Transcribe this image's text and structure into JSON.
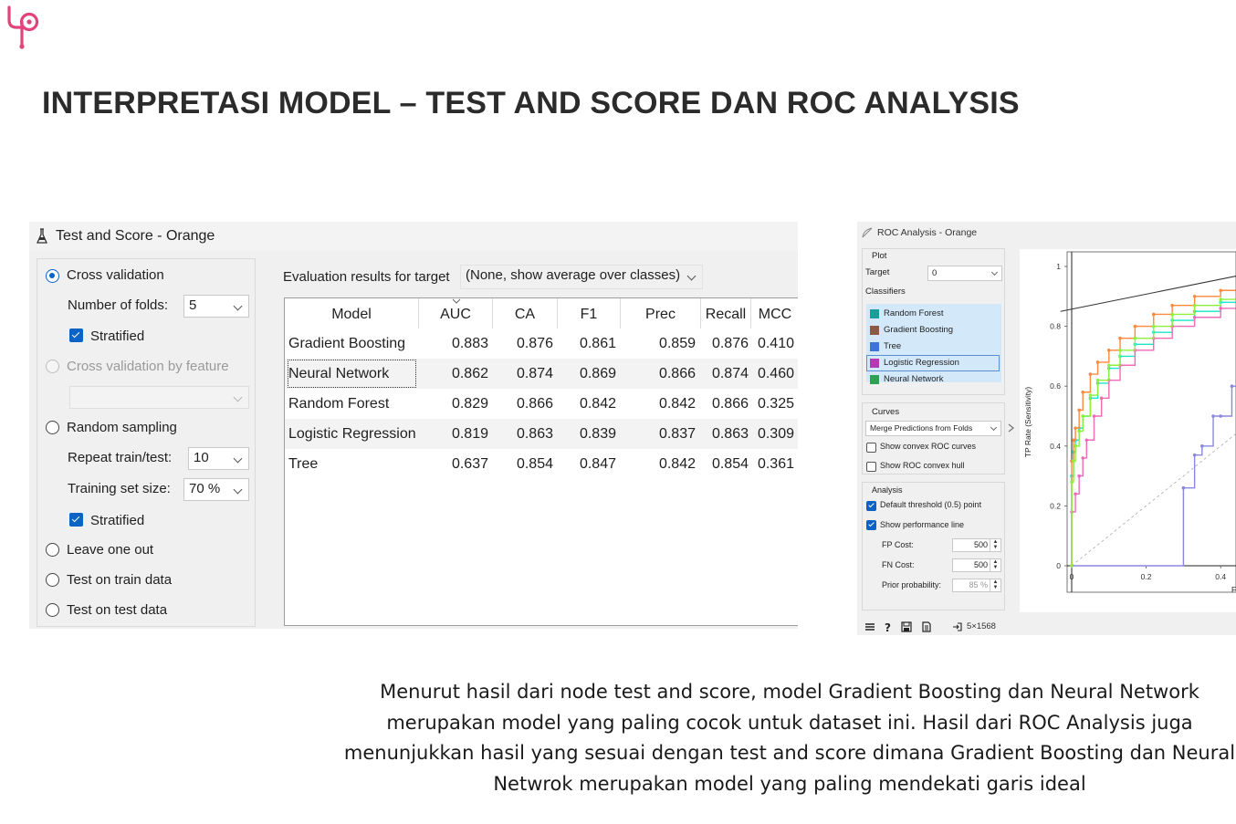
{
  "slide": {
    "title": "INTERPRETASI MODEL – TEST AND SCORE DAN ROC ANALYSIS",
    "caption": "Menurut hasil dari node test and score, model Gradient Boosting dan Neural Network merupakan model yang paling cocok untuk dataset ini. Hasil dari ROC Analysis juga menunjukkan hasil yang sesuai dengan test and score dimana Gradient Boosting dan Neural Netwrok merupakan model yang paling mendekati garis ideal",
    "accent_color": "#e0447a",
    "logo_icon": "brand-logo-icon"
  },
  "test_and_score": {
    "window_title": "Test and Score - Orange",
    "sampling": {
      "cross_validation": "Cross validation",
      "number_of_folds_label": "Number of folds:",
      "number_of_folds": "5",
      "stratified_1": "Stratified",
      "cross_validation_by_feature": "Cross validation by feature",
      "feature_value": "",
      "random_sampling": "Random sampling",
      "repeat_label": "Repeat train/test:",
      "repeat_value": "10",
      "training_size_label": "Training set size:",
      "training_size_value": "70 %",
      "stratified_2": "Stratified",
      "leave_one_out": "Leave one out",
      "test_on_train": "Test on train data",
      "test_on_test": "Test on test data",
      "selected": "Cross validation"
    },
    "eval_label": "Evaluation results for target",
    "eval_target": "(None, show average over classes)",
    "columns": [
      "Model",
      "AUC",
      "CA",
      "F1",
      "Prec",
      "Recall",
      "MCC"
    ],
    "sorted_column": "AUC",
    "rows": [
      {
        "model": "Gradient Boosting",
        "auc": "0.883",
        "ca": "0.876",
        "f1": "0.861",
        "prec": "0.859",
        "recall": "0.876",
        "mcc": "0.410"
      },
      {
        "model": "Neural Network",
        "auc": "0.862",
        "ca": "0.874",
        "f1": "0.869",
        "prec": "0.866",
        "recall": "0.874",
        "mcc": "0.460"
      },
      {
        "model": "Random Forest",
        "auc": "0.829",
        "ca": "0.866",
        "f1": "0.842",
        "prec": "0.842",
        "recall": "0.866",
        "mcc": "0.325"
      },
      {
        "model": "Logistic Regression",
        "auc": "0.819",
        "ca": "0.863",
        "f1": "0.839",
        "prec": "0.837",
        "recall": "0.863",
        "mcc": "0.309"
      },
      {
        "model": "Tree",
        "auc": "0.637",
        "ca": "0.854",
        "f1": "0.847",
        "prec": "0.842",
        "recall": "0.854",
        "mcc": "0.361"
      }
    ]
  },
  "roc": {
    "window_title": "ROC Analysis - Orange",
    "plot_box_label": "Plot",
    "target_label": "Target",
    "target_value": "0",
    "classifiers_label": "Classifiers",
    "classifiers": [
      {
        "name": "Random Forest",
        "color": "#1a9e9a"
      },
      {
        "name": "Gradient Boosting",
        "color": "#8a5a44"
      },
      {
        "name": "Tree",
        "color": "#3f73d6"
      },
      {
        "name": "Logistic Regression",
        "color": "#b23ab5"
      },
      {
        "name": "Neural Network",
        "color": "#2ea253"
      }
    ],
    "curves_label": "Curves",
    "merge_option": "Merge Predictions from Folds",
    "show_convex_curves": "Show convex ROC curves",
    "show_convex_hull": "Show ROC convex hull",
    "analysis_label": "Analysis",
    "default_threshold": "Default threshold (0.5) point",
    "show_performance_line": "Show performance line",
    "fp_cost_label": "FP Cost:",
    "fp_cost": "500",
    "fn_cost_label": "FN Cost:",
    "fn_cost": "500",
    "prior_label": "Prior probability:",
    "prior_value": "85 %",
    "status_size": "5×1568",
    "y_axis_label": "TP Rate (Sensitivity)",
    "x_axis_label": "FP Ra",
    "y_ticks": [
      "1",
      "0.8",
      "0.6",
      "0.4",
      "0.2",
      "0"
    ],
    "x_ticks": [
      "0",
      "0.2",
      "0.4"
    ],
    "chart_data": {
      "type": "line",
      "title": "",
      "xlabel": "FP Ra",
      "ylabel": "TP Rate (Sensitivity)",
      "xlim": [
        0,
        0.45
      ],
      "ylim": [
        0,
        1.05
      ],
      "series": [
        {
          "name": "Random Forest",
          "color": "#19e6c8",
          "x": [
            0,
            0,
            0.005,
            0.01,
            0.02,
            0.03,
            0.05,
            0.07,
            0.1,
            0.13,
            0.17,
            0.22,
            0.27,
            0.33,
            0.4,
            0.45
          ],
          "y": [
            0,
            0.3,
            0.38,
            0.42,
            0.46,
            0.5,
            0.56,
            0.61,
            0.66,
            0.7,
            0.74,
            0.78,
            0.82,
            0.85,
            0.88,
            0.9
          ]
        },
        {
          "name": "Gradient Boosting",
          "color": "#ff8a3d",
          "x": [
            0,
            0,
            0.005,
            0.01,
            0.02,
            0.03,
            0.05,
            0.07,
            0.1,
            0.13,
            0.17,
            0.22,
            0.27,
            0.33,
            0.4,
            0.45
          ],
          "y": [
            0,
            0.35,
            0.42,
            0.46,
            0.52,
            0.58,
            0.64,
            0.68,
            0.72,
            0.76,
            0.8,
            0.84,
            0.87,
            0.9,
            0.92,
            0.93
          ]
        },
        {
          "name": "Tree",
          "color": "#8a87e0",
          "x": [
            0,
            0.3,
            0.33,
            0.35,
            0.38,
            0.4,
            0.43,
            0.45
          ],
          "y": [
            0,
            0.26,
            0.37,
            0.4,
            0.5,
            0.5,
            0.6,
            0.66
          ]
        },
        {
          "name": "Logistic Regression",
          "color": "#f06ab8",
          "x": [
            0,
            0,
            0.01,
            0.02,
            0.03,
            0.04,
            0.06,
            0.08,
            0.1,
            0.13,
            0.17,
            0.22,
            0.27,
            0.33,
            0.4,
            0.45
          ],
          "y": [
            0,
            0.18,
            0.24,
            0.3,
            0.36,
            0.42,
            0.5,
            0.56,
            0.62,
            0.67,
            0.72,
            0.76,
            0.8,
            0.83,
            0.86,
            0.88
          ]
        },
        {
          "name": "Neural Network",
          "color": "#8ef03c",
          "x": [
            0,
            0,
            0.005,
            0.01,
            0.02,
            0.03,
            0.05,
            0.07,
            0.1,
            0.13,
            0.17,
            0.22,
            0.27,
            0.33,
            0.4,
            0.45
          ],
          "y": [
            0,
            0.28,
            0.35,
            0.4,
            0.45,
            0.5,
            0.57,
            0.62,
            0.67,
            0.72,
            0.76,
            0.8,
            0.84,
            0.87,
            0.89,
            0.91
          ]
        }
      ],
      "reference_diagonal": true,
      "performance_line": {
        "x": [
          -0.03,
          0.45
        ],
        "y": [
          0.85,
          0.97
        ]
      },
      "grid": false
    }
  }
}
